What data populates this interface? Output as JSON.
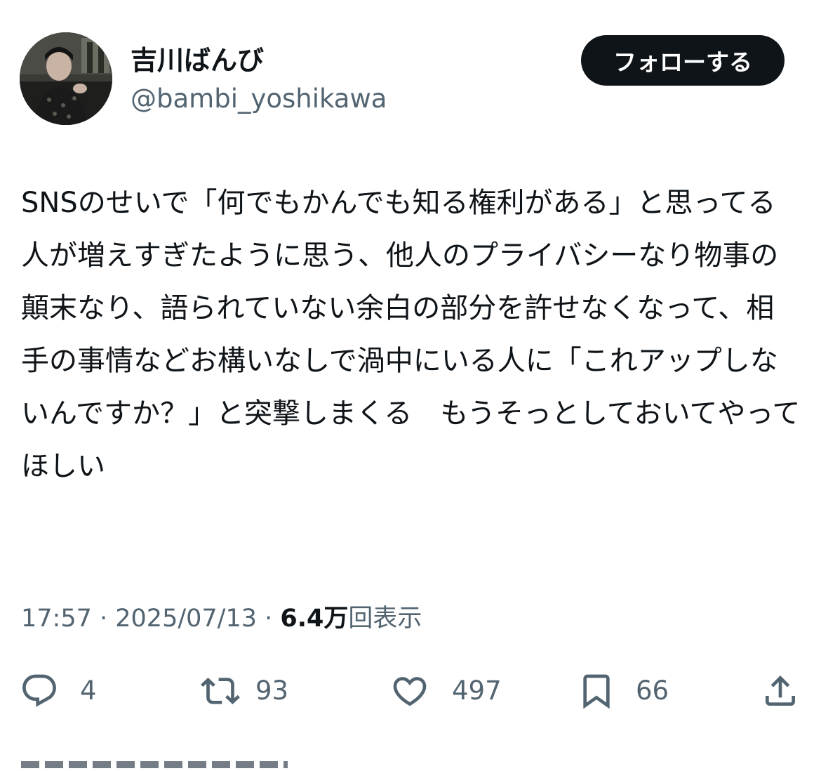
{
  "author": {
    "display_name": "吉川ばんび",
    "handle": "@bambi_yoshikawa",
    "avatar_icon": "profile-photo"
  },
  "follow_button": {
    "label": "フォローする"
  },
  "tweet": {
    "text": "SNSのせいで「何でもかんでも知る権利がある」と思ってる人が増えすぎたように思う、他人のプライバシーなり物事の顛末なり、語られていない余白の部分を許せなくなって、相手の事情などお構いなしで渦中にいる人に「これアップしないんですか？」と突撃しまくる　もうそっとしておいてやってほしい"
  },
  "meta": {
    "time": "17:57",
    "separator": " · ",
    "date": "2025/07/13",
    "views_count": "6.4万",
    "views_label": "回表示"
  },
  "actions": {
    "reply": {
      "icon": "reply-icon",
      "count": "4"
    },
    "retweet": {
      "icon": "retweet-icon",
      "count": "93"
    },
    "like": {
      "icon": "heart-icon",
      "count": "497"
    },
    "bookmark": {
      "icon": "bookmark-icon",
      "count": "66"
    },
    "share": {
      "icon": "share-icon"
    }
  },
  "colors": {
    "text_primary": "#0f1419",
    "text_secondary": "#536471",
    "button_background": "#0f1419",
    "button_text": "#ffffff",
    "background": "#ffffff"
  }
}
